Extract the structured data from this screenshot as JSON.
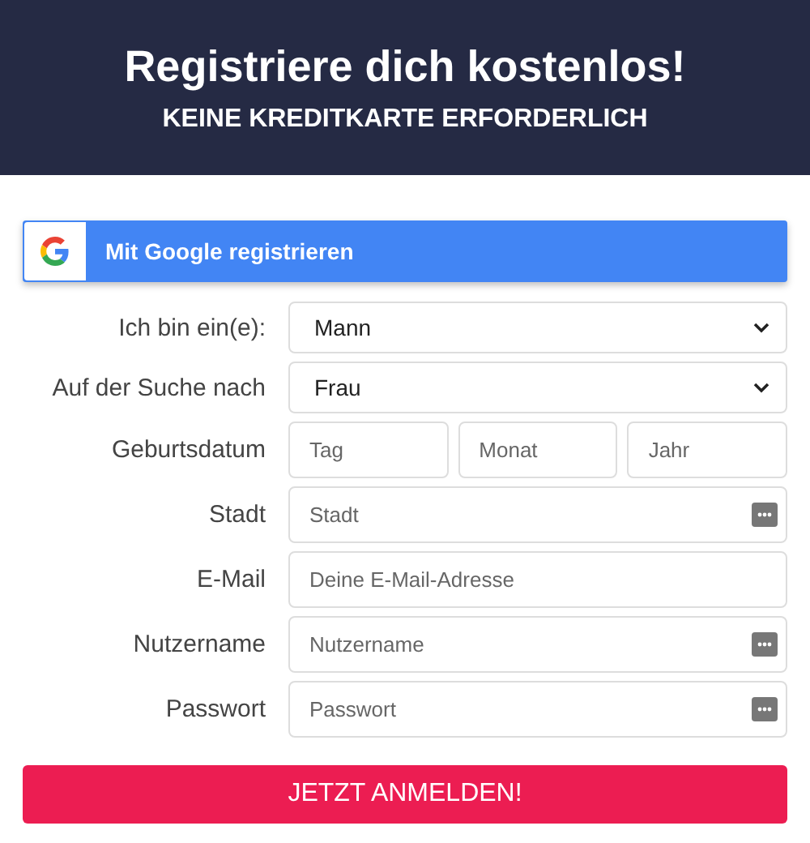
{
  "header": {
    "title": "Registriere dich kostenlos!",
    "subtitle": "KEINE KREDITKARTE ERFORDERLICH"
  },
  "google_button": {
    "label": "Mit Google registrieren"
  },
  "fields": [
    {
      "kind": "select",
      "label": "Ich bin ein(e):",
      "value": "Mann"
    },
    {
      "kind": "select",
      "label": "Auf der Suche nach",
      "value": "Frau"
    },
    {
      "kind": "date",
      "label": "Geburtsdatum",
      "parts": [
        {
          "placeholder": "Tag"
        },
        {
          "placeholder": "Monat"
        },
        {
          "placeholder": "Jahr"
        }
      ]
    },
    {
      "kind": "text",
      "label": "Stadt",
      "placeholder": "Stadt",
      "autofill_icon": true
    },
    {
      "kind": "text",
      "label": "E-Mail",
      "placeholder": "Deine E-Mail-Adresse",
      "autofill_icon": false
    },
    {
      "kind": "text",
      "label": "Nutzername",
      "placeholder": "Nutzername",
      "autofill_icon": true
    },
    {
      "kind": "text",
      "label": "Passwort",
      "placeholder": "Passwort",
      "autofill_icon": true
    }
  ],
  "submit_button": {
    "label": "JETZT ANMELDEN!"
  }
}
